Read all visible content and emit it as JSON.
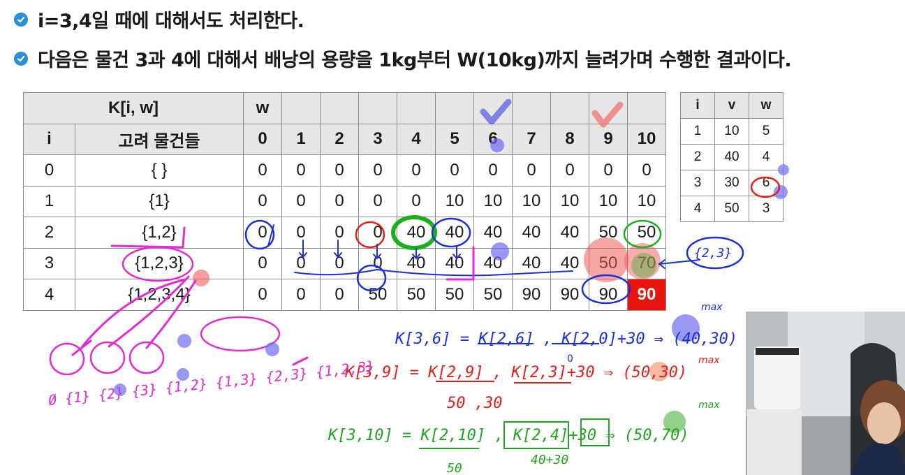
{
  "bullets": [
    "i=3,4일 때에 대해서도 처리한다.",
    "다음은 물건 3과 4에 대해서 배낭의 용량을 1kg부터 W(10kg)까지 늘려가며 수행한 결과이다."
  ],
  "dp_table": {
    "header_title": "K[i, w]",
    "header_w": "w",
    "col_i": "i",
    "col_items": "고려 물건들",
    "w_values": [
      "0",
      "1",
      "2",
      "3",
      "4",
      "5",
      "6",
      "7",
      "8",
      "9",
      "10"
    ],
    "rows": [
      {
        "i": "0",
        "items": "{ }",
        "values": [
          "0",
          "0",
          "0",
          "0",
          "0",
          "0",
          "0",
          "0",
          "0",
          "0",
          "0"
        ]
      },
      {
        "i": "1",
        "items": "{1}",
        "values": [
          "0",
          "0",
          "0",
          "0",
          "0",
          "10",
          "10",
          "10",
          "10",
          "10",
          "10"
        ]
      },
      {
        "i": "2",
        "items": "{1,2}",
        "values": [
          "0",
          "0",
          "0",
          "0",
          "40",
          "40",
          "40",
          "40",
          "40",
          "50",
          "50"
        ]
      },
      {
        "i": "3",
        "items": "{1,2,3}",
        "values": [
          "0",
          "0",
          "0",
          "0",
          "40",
          "40",
          "40",
          "40",
          "40",
          "50",
          "70"
        ]
      },
      {
        "i": "4",
        "items": "{1,2,3,4}",
        "values": [
          "0",
          "0",
          "0",
          "50",
          "50",
          "50",
          "50",
          "90",
          "90",
          "90",
          "90"
        ]
      }
    ]
  },
  "item_table": {
    "headers": [
      "i",
      "v",
      "w"
    ],
    "rows": [
      [
        "1",
        "10",
        "5"
      ],
      [
        "2",
        "40",
        "4"
      ],
      [
        "3",
        "30",
        "6"
      ],
      [
        "4",
        "50",
        "3"
      ]
    ]
  },
  "handwriting": {
    "blue_eq": "K[3,6] = K[2,6] , K[2,0]+30 ⇒ (40,30)",
    "blue_max": "max",
    "red_eq": "K[3,9] = K[2,9] , K[2,3]+30 ⇒ (50,30)",
    "red_max": "max",
    "red_sub": "50   ,30",
    "green_eq": "K[3,10] = K[2,10] , K[2,4]+30 ⇒ (50,70)",
    "green_max": "max",
    "green_sub": "40+30",
    "green_50": "50",
    "set_note": "{2,3}",
    "magenta_sets": "Ø {1} {2} {3} {1,2} {1,3} {2,3} {1,2,3}",
    "zero_mark": "0"
  },
  "colors": {
    "bullet": "#2b8fd6",
    "final_cell": "#e8140e",
    "blue_ink": "#1a2fd6",
    "red_ink": "#e0201c",
    "green_ink": "#22a322",
    "magenta_ink": "#e02cd0"
  }
}
